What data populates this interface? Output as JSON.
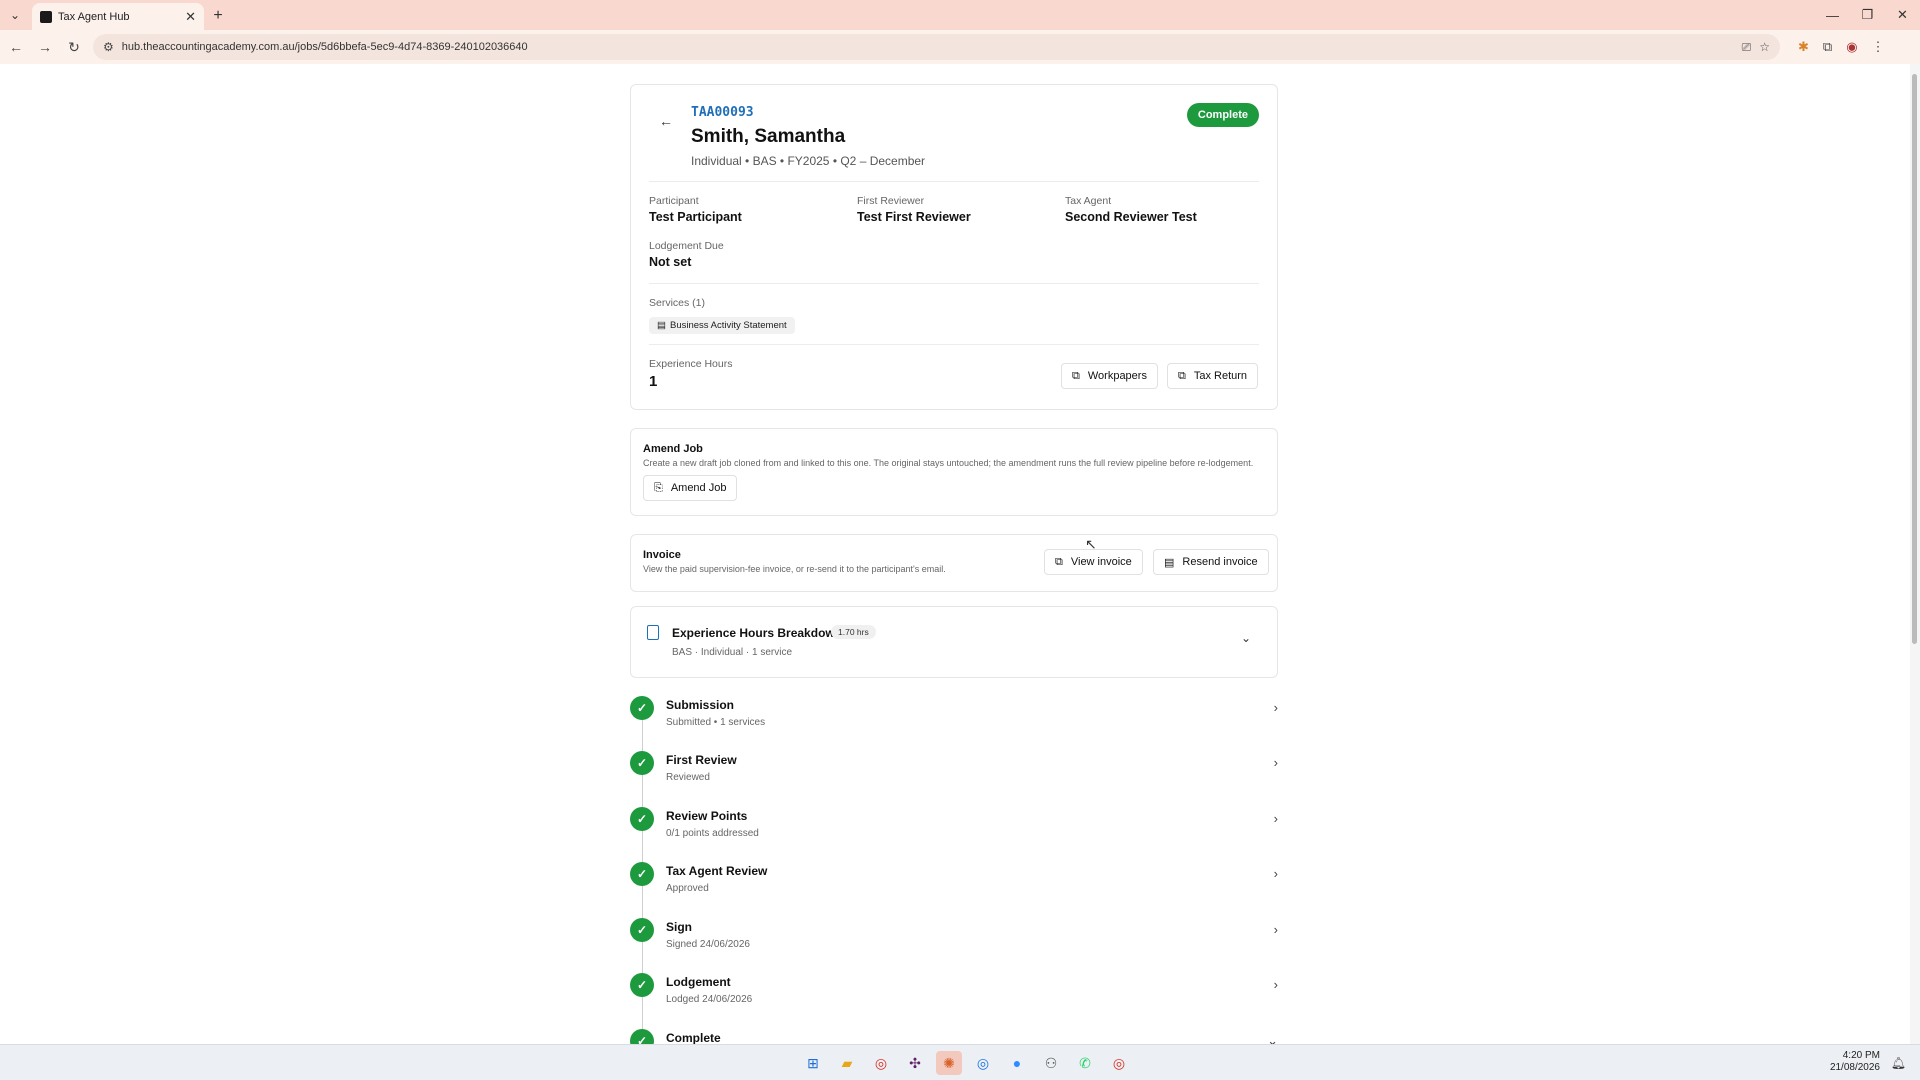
{
  "browser": {
    "tab_title": "Tax Agent Hub",
    "url": "hub.theaccountingacademy.com.au/jobs/5d6bbefa-5ec9-4d74-8369-240102036640"
  },
  "job": {
    "id": "TAA00093",
    "client_name": "Smith, Samantha",
    "subtitle": "Individual • BAS • FY2025 • Q2 – December",
    "status": "Complete",
    "participant_label": "Participant",
    "participant": "Test Participant",
    "first_reviewer_label": "First Reviewer",
    "first_reviewer": "Test First Reviewer",
    "tax_agent_label": "Tax Agent",
    "tax_agent": "Second Reviewer Test",
    "lodgement_due_label": "Lodgement Due",
    "lodgement_due": "Not set",
    "services_label": "Services (1)",
    "service": "Business Activity Statement",
    "experience_hours_label": "Experience Hours",
    "experience_hours": "1",
    "workpapers_label": "Workpapers",
    "tax_return_label": "Tax Return"
  },
  "amend": {
    "title": "Amend Job",
    "description": "Create a new draft job cloned from and linked to this one. The original stays untouched; the amendment runs the full review pipeline before re-lodgement.",
    "button": "Amend Job"
  },
  "invoice": {
    "title": "Invoice",
    "description": "View the paid supervision-fee invoice, or re-send it to the participant's email.",
    "view_button": "View invoice",
    "resend_button": "Resend invoice"
  },
  "breakdown": {
    "title": "Experience Hours Breakdown",
    "badge": "1.70 hrs",
    "subtitle": "BAS · Individual · 1 service"
  },
  "steps": [
    {
      "title": "Submission",
      "subtitle": "Submitted • 1 services"
    },
    {
      "title": "First Review",
      "subtitle": "Reviewed"
    },
    {
      "title": "Review Points",
      "subtitle": "0/1 points addressed"
    },
    {
      "title": "Tax Agent Review",
      "subtitle": "Approved"
    },
    {
      "title": "Sign",
      "subtitle": "Signed 24/06/2026"
    },
    {
      "title": "Lodgement",
      "subtitle": "Lodged 24/06/2026"
    },
    {
      "title": "Complete",
      "subtitle": ""
    }
  ],
  "taskbar": {
    "time": "4:20 PM",
    "date": "21/08/2026"
  },
  "colors": {
    "accent_blue": "#1f6fb8",
    "success_green": "#1e9a3e",
    "chrome_tab": "#f9d9cf"
  }
}
